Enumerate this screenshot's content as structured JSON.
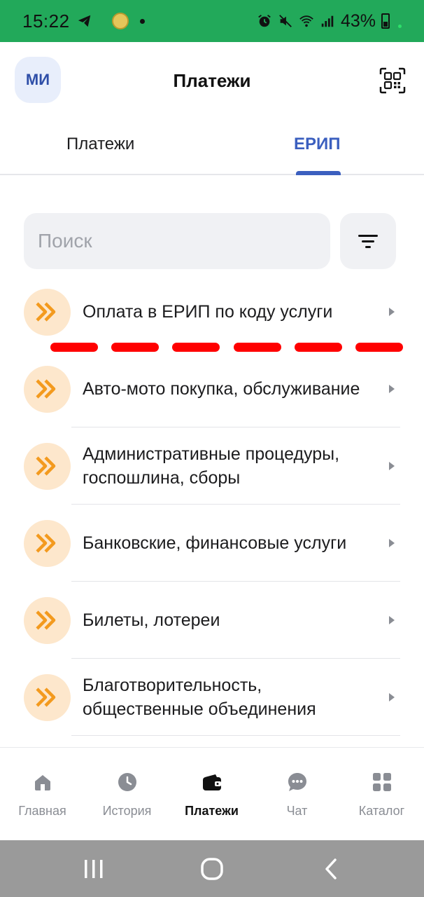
{
  "status_bar": {
    "time": "15:22",
    "battery_percent": "43%"
  },
  "header": {
    "avatar_initials": "МИ",
    "title": "Платежи"
  },
  "tabs": [
    {
      "label": "Платежи",
      "active": false
    },
    {
      "label": "ЕРИП",
      "active": true
    }
  ],
  "search": {
    "placeholder": "Поиск"
  },
  "list": {
    "items": [
      {
        "label": "Оплата в ЕРИП по коду услуги"
      },
      {
        "label": "Авто-мото покупка, обслуживание"
      },
      {
        "label": "Административные процедуры, госпошлина, сборы"
      },
      {
        "label": "Банковские, финансовые услуги"
      },
      {
        "label": "Билеты, лотереи"
      },
      {
        "label": "Благотворительность, общественные объединения"
      }
    ]
  },
  "bottom_nav": {
    "items": [
      {
        "label": "Главная",
        "icon": "home-icon",
        "active": false
      },
      {
        "label": "История",
        "icon": "clock-icon",
        "active": false
      },
      {
        "label": "Платежи",
        "icon": "wallet-icon",
        "active": true
      },
      {
        "label": "Чат",
        "icon": "chat-icon",
        "active": false
      },
      {
        "label": "Каталог",
        "icon": "grid-icon",
        "active": false
      }
    ]
  },
  "colors": {
    "status_bar": "#22a95a",
    "accent": "#3b5fbf",
    "badge_bg": "#fde7cc",
    "badge_icon": "#f39a1e",
    "dash_annotation": "#ff0000"
  }
}
